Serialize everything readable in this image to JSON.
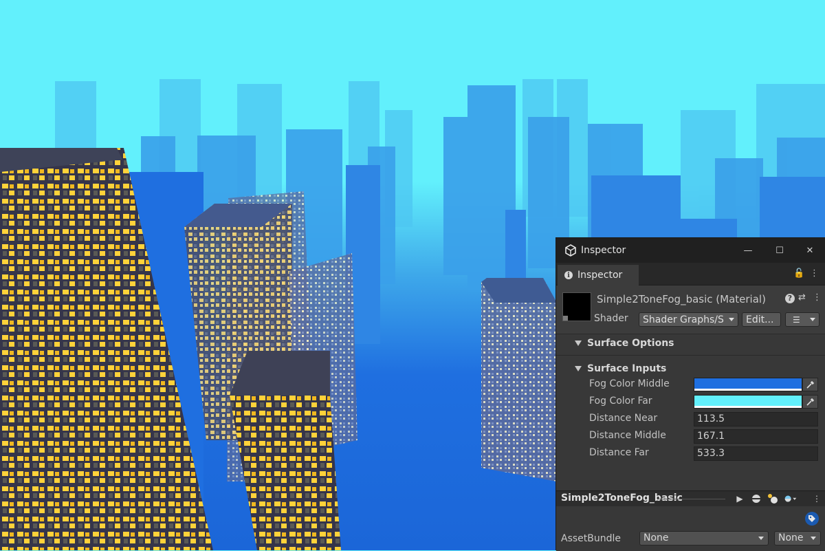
{
  "window": {
    "title": "Inspector",
    "minimize_glyph": "—",
    "maximize_glyph": "☐",
    "close_glyph": "✕"
  },
  "tab": {
    "label": "Inspector",
    "info_glyph": "i",
    "lock_glyph": "🔓",
    "menu_glyph": "⋮"
  },
  "material": {
    "name": "Simple2ToneFog_basic (Material)",
    "shader_label": "Shader",
    "shader_value": "Shader Graphs/S",
    "edit_label": "Edit...",
    "list_glyph": "☰",
    "help_glyph": "?",
    "settings_glyph": "⇄",
    "more_glyph": "⋮"
  },
  "sections": {
    "surface_options": "Surface Options",
    "surface_inputs": "Surface Inputs"
  },
  "properties": [
    {
      "label": "Fog Color Middle",
      "type": "color",
      "color": "#1f6fe0"
    },
    {
      "label": "Fog Color Far",
      "type": "color",
      "color": "#62f0fc"
    },
    {
      "label": "Distance Near",
      "type": "number",
      "value": "113.5"
    },
    {
      "label": "Distance Middle",
      "type": "number",
      "value": "167.1"
    },
    {
      "label": "Distance Far",
      "type": "number",
      "value": "533.3"
    }
  ],
  "asset_preview": {
    "name": "Simple2ToneFog_basic",
    "play_glyph": "▶",
    "more_glyph": "⋮"
  },
  "asset_bundle": {
    "label": "AssetBundle",
    "name_value": "None",
    "variant_value": "None"
  },
  "colors": {
    "sky": "#62f0fc",
    "fog_middle": "#1f6fe0",
    "window_light": "#ffd23a",
    "panel_bg": "#383838"
  }
}
